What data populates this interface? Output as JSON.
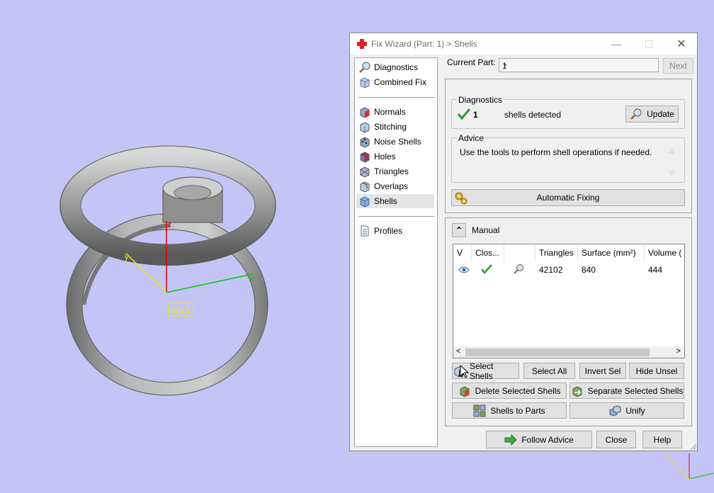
{
  "scene": {
    "axis_label": "WCS",
    "axis_x": "x",
    "axis_y": "y",
    "axis_z": "z"
  },
  "window": {
    "title": "Fix Wizard (Part: 1) > Shells",
    "controls": {
      "minimize": "—",
      "maximize": "☐",
      "close": "✕"
    }
  },
  "sidebar": {
    "group1": [
      {
        "label": "Diagnostics",
        "icon": "magnifier-icon"
      },
      {
        "label": "Combined Fix",
        "icon": "cube-icon"
      }
    ],
    "group2": [
      {
        "label": "Normals",
        "icon": "normals-cube-icon"
      },
      {
        "label": "Stitching",
        "icon": "stitching-cube-icon"
      },
      {
        "label": "Noise Shells",
        "icon": "noise-shells-icon"
      },
      {
        "label": "Holes",
        "icon": "holes-cube-icon"
      },
      {
        "label": "Triangles",
        "icon": "triangles-cube-icon"
      },
      {
        "label": "Overlaps",
        "icon": "overlaps-cube-icon"
      },
      {
        "label": "Shells",
        "icon": "shells-cube-icon",
        "selected": true
      }
    ],
    "group3": [
      {
        "label": "Profiles",
        "icon": "document-icon"
      }
    ]
  },
  "top": {
    "current_part_label": "Current Part:",
    "current_part_value": "1",
    "next_label": "Next"
  },
  "diagnostics": {
    "title": "Diagnostics",
    "count": "1",
    "text": "shells detected",
    "update_label": "Update"
  },
  "advice": {
    "title": "Advice",
    "text": "Use the tools to perform shell operations if needed."
  },
  "auto_fix_label": "Automatic Fixing",
  "manual": {
    "toggle": "⌃",
    "title": "Manual",
    "table": {
      "columns": [
        "V",
        "Clos...",
        "",
        "Triangles",
        "Surface (mm²)",
        "Volume ("
      ],
      "rows": [
        {
          "triangles": "42102",
          "surface": "840",
          "volume": "444"
        }
      ]
    },
    "scroll_left": "<",
    "scroll_right": ">",
    "buttons": {
      "select_shells": "Select Shells",
      "select_all": "Select All",
      "invert_sel": "Invert Sel",
      "hide_unsel": "Hide Unsel",
      "delete_selected": "Delete Selected Shells",
      "separate_selected": "Separate Selected Shells",
      "shells_to_parts": "Shells to Parts",
      "unify": "Unify"
    }
  },
  "footer": {
    "follow_advice": "Follow Advice",
    "close": "Close",
    "help": "Help"
  },
  "colors": {
    "background": "#c4c4f6",
    "ring": "#8a8a8a",
    "accent_check": "#2e9a2e",
    "red_cross": "#e02020"
  }
}
